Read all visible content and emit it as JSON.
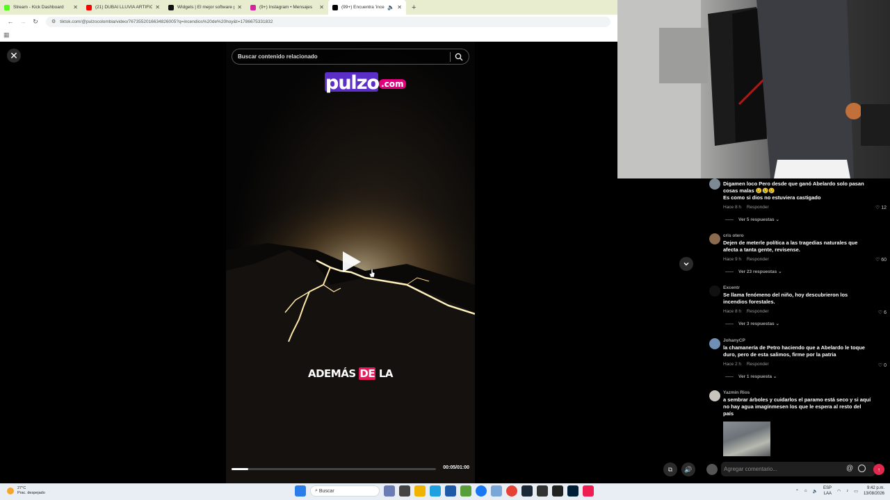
{
  "browser": {
    "tabs": [
      {
        "title": "Stream - Kick Dashboard",
        "favicon_color": "#53fc18",
        "icon": "kick-icon"
      },
      {
        "title": "(21) DUBAI LLUVIA ARTIFICIAL",
        "favicon_color": "#ff0000",
        "icon": "youtube-icon"
      },
      {
        "title": "Widgets | El mejor software pa",
        "favicon_color": "#111111",
        "icon": "widget-icon"
      },
      {
        "title": "(9+) Instagram • Mensajes",
        "favicon_color": "#d6249f",
        "icon": "instagram-icon"
      },
      {
        "title": "(99+) Encuentra 'incendios d",
        "favicon_color": "#000000",
        "icon": "tiktok-icon",
        "active": true
      }
    ],
    "new_tab": "+",
    "url": "tiktok.com/@pulzocolombia/video/7673552016634826005?q=incendios%20de%20hoy&t=1786675331832"
  },
  "viewer": {
    "search_placeholder": "Buscar contenido relacionado",
    "logo_text": "pulzo",
    "logo_suffix": ".com",
    "caption_pre": "ADEMÁS",
    "caption_hl": "DE",
    "caption_post": "LA",
    "timecode": "00:05/01:00",
    "progress": 0.083
  },
  "comments": [
    {
      "user": "",
      "text": "Digamen loco Pero desde que ganó Abelardo solo pasan cosas malas 😢😢😢",
      "text2": "Es como si dios no estuviera castigado",
      "time": "Hace 8 h",
      "reply": "Responder",
      "likes": "12",
      "replies": "Ver 5 respuestas"
    },
    {
      "user": "cris otero",
      "text": "Dejen de meterle política a las tragedias naturales que afecta a tanta gente, revisense.",
      "time": "Hace 9 h",
      "reply": "Responder",
      "likes": "60",
      "replies": "Ver 23 respuestas"
    },
    {
      "user": "Excentr",
      "text": "Se llama fenómeno del niño, hoy descubrieron los incendios forestales.",
      "time": "Hace 8 h",
      "reply": "Responder",
      "likes": "6",
      "replies": "Ver 3 respuestas"
    },
    {
      "user": "JohanyCP",
      "text": "la chamanería de Petro haciendo que a Abelardo le toque duro, pero de esta salimos, firme por la patria",
      "time": "Hace 2 h",
      "reply": "Responder",
      "likes": "0",
      "replies": "Ver 1 respuesta"
    },
    {
      "user": "Yazmin Rios",
      "text": "a sembrar árboles y cuidarlos el paramo está seco y si aquí no hay agua imagínmesen los que le espera al resto del país"
    }
  ],
  "comment_bar": {
    "placeholder": "Agregar comentario...",
    "at": "@"
  },
  "taskbar": {
    "temp": "27°C",
    "weather": "Prac. despejado",
    "search": "Buscar",
    "lang1": "ESP",
    "lang2": "LAA",
    "time": "9:42 p.m.",
    "date": "13/08/2026"
  }
}
